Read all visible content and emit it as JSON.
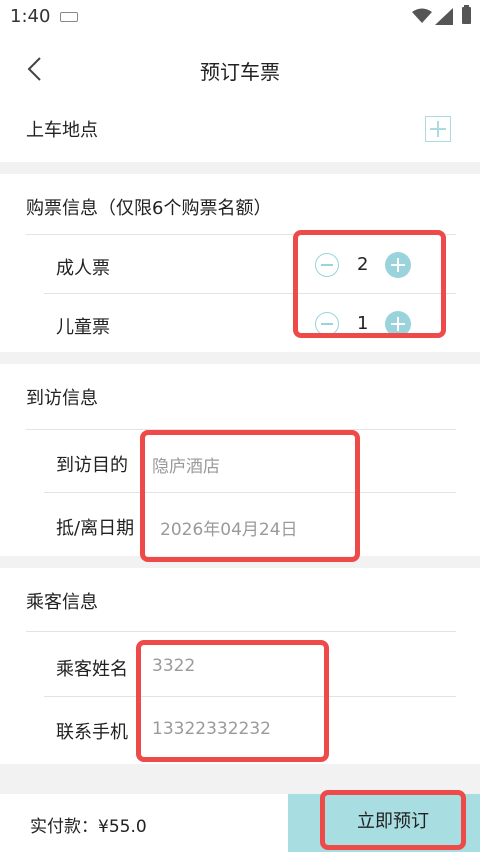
{
  "status_bar": {
    "time": "1:40"
  },
  "header": {
    "title": "预订车票",
    "back_icon": "chevron-left-icon"
  },
  "boarding": {
    "title": "上车地点",
    "add_icon": "plus-square-icon"
  },
  "tickets": {
    "title": "购票信息（仅限6个购票名额）",
    "adult": {
      "label": "成人票",
      "count": "2"
    },
    "child": {
      "label": "儿童票",
      "count": "1"
    }
  },
  "visit": {
    "title": "到访信息",
    "destination": {
      "label": "到访目的",
      "value": "隐庐酒店"
    },
    "dates": {
      "label": "抵/离日期",
      "value": "2026年04月24日"
    }
  },
  "passenger": {
    "title": "乘客信息",
    "name": {
      "label": "乘客姓名",
      "value": "3322"
    },
    "phone": {
      "label": "联系手机",
      "value": "13322332232"
    }
  },
  "footer": {
    "pay_label": "实付款：¥55.0",
    "book_button": "立即预订"
  },
  "colors": {
    "accent": "#9ad3dc",
    "book_bg": "#a8dde1",
    "highlight": "#ef4a4a"
  }
}
